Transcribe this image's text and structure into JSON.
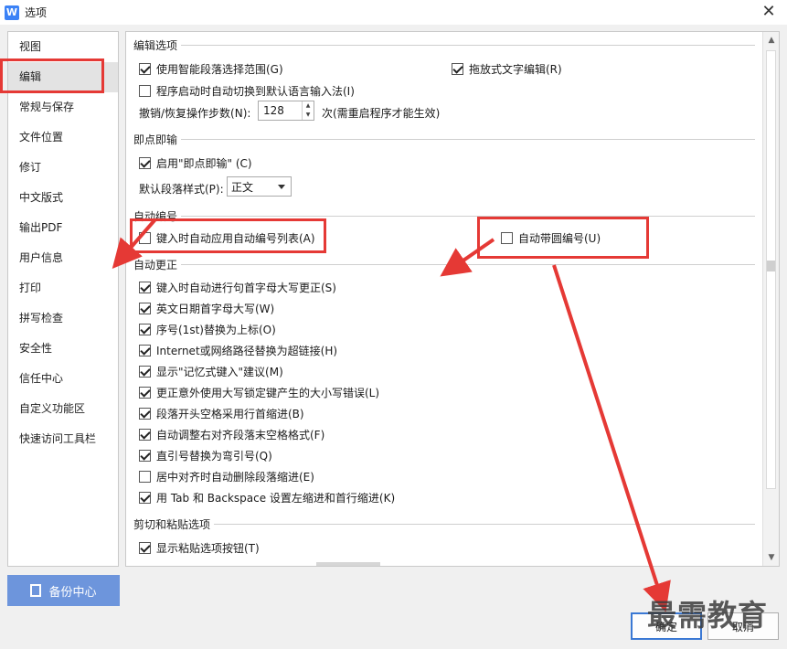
{
  "window": {
    "title": "选项",
    "app_icon_letter": "W",
    "close_glyph": "✕"
  },
  "sidebar": {
    "items": [
      {
        "label": "视图"
      },
      {
        "label": "编辑"
      },
      {
        "label": "常规与保存"
      },
      {
        "label": "文件位置"
      },
      {
        "label": "修订"
      },
      {
        "label": "中文版式"
      },
      {
        "label": "输出PDF"
      },
      {
        "label": "用户信息"
      },
      {
        "label": "打印"
      },
      {
        "label": "拼写检查"
      },
      {
        "label": "安全性"
      },
      {
        "label": "信任中心"
      },
      {
        "label": "自定义功能区"
      },
      {
        "label": "快速访问工具栏"
      }
    ],
    "active_index": 1
  },
  "sections": {
    "edit": {
      "title": "编辑选项",
      "smart_select": {
        "label": "使用智能段落选择范围(G)",
        "checked": true
      },
      "drag_edit": {
        "label": "拖放式文字编辑(R)",
        "checked": true
      },
      "auto_ime": {
        "label": "程序启动时自动切换到默认语言输入法(I)",
        "checked": false
      },
      "undo_label": "撤销/恢复操作步数(N):",
      "undo_value": "128",
      "undo_suffix": "次(需重启程序才能生效)"
    },
    "click_type": {
      "title": "即点即输",
      "enable": {
        "label": "启用\"即点即输\" (C)",
        "checked": true
      },
      "style_label": "默认段落样式(P):",
      "style_value": "正文"
    },
    "auto_number": {
      "title": "自动编号",
      "apply_list": {
        "label": "键入时自动应用自动编号列表(A)",
        "checked": false
      },
      "circle_number": {
        "label": "自动带圆编号(U)",
        "checked": false
      }
    },
    "autocorrect": {
      "title": "自动更正",
      "items": [
        {
          "label": "键入时自动进行句首字母大写更正(S)",
          "checked": true
        },
        {
          "label": "英文日期首字母大写(W)",
          "checked": true
        },
        {
          "label": "序号(1st)替换为上标(O)",
          "checked": true
        },
        {
          "label": "Internet或网络路径替换为超链接(H)",
          "checked": true
        },
        {
          "label": "显示\"记忆式键入\"建议(M)",
          "checked": true
        },
        {
          "label": "更正意外使用大写锁定键产生的大小写错误(L)",
          "checked": true
        },
        {
          "label": "段落开头空格采用行首缩进(B)",
          "checked": true
        },
        {
          "label": "自动调整右对齐段落末空格格式(F)",
          "checked": true
        },
        {
          "label": "直引号替换为弯引号(Q)",
          "checked": true
        },
        {
          "label": "居中对齐时自动删除段落缩进(E)",
          "checked": false
        },
        {
          "label": "用 Tab 和 Backspace 设置左缩进和首行缩进(K)",
          "checked": true
        }
      ]
    },
    "paste": {
      "title": "剪切和粘贴选项",
      "show_btn": {
        "label": "显示粘贴选项按钮(T)",
        "checked": true
      }
    }
  },
  "footer": {
    "backup_label": "备份中心",
    "ok_label": "确定",
    "cancel_label": "取消"
  },
  "watermark": "最需教育",
  "colors": {
    "annotation_red": "#e53935",
    "backup_blue": "#6d95dc",
    "accent_blue": "#3a78d4"
  }
}
